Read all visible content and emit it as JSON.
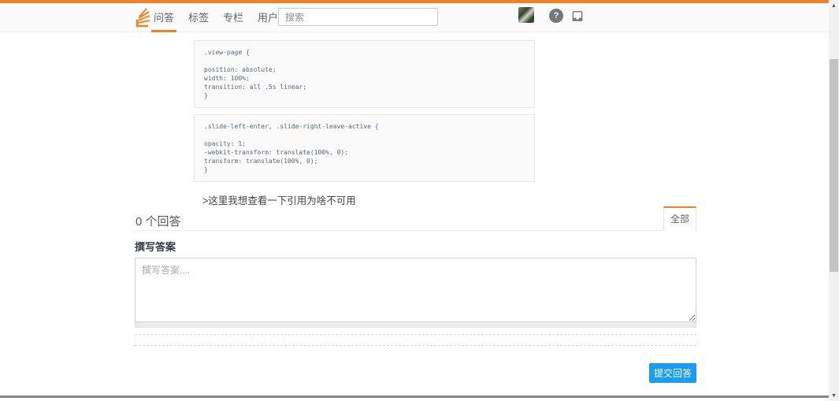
{
  "header": {
    "search_placeholder": "搜索",
    "nav": [
      {
        "label": "问答"
      },
      {
        "label": "标签"
      },
      {
        "label": "专栏"
      },
      {
        "label": "用户"
      }
    ],
    "help_glyph": "?"
  },
  "question": {
    "code_blocks": [
      ".view-page {\n\nposition: absolute;\nwidth: 100%;\ntransition: all .5s linear;\n}",
      ".slide-left-enter, .slide-right-leave-active {\n\nopacity: 1;\n-webkit-transform: translate(100%, 0);\ntransform: translate(100%, 0);\n}"
    ],
    "note": ">这里我想查看一下引用为啥不可用"
  },
  "answers": {
    "count_label": "0 个回答",
    "filter_tab": "全部"
  },
  "compose": {
    "heading": "撰写答案",
    "editor_placeholder": "撰写答案....",
    "submit_label": "提交回答"
  },
  "scrollbar": {
    "up_glyph": "▲",
    "down_glyph": "▼"
  },
  "colors": {
    "accent_orange": "#f48024",
    "submit_blue": "#189cf4"
  }
}
